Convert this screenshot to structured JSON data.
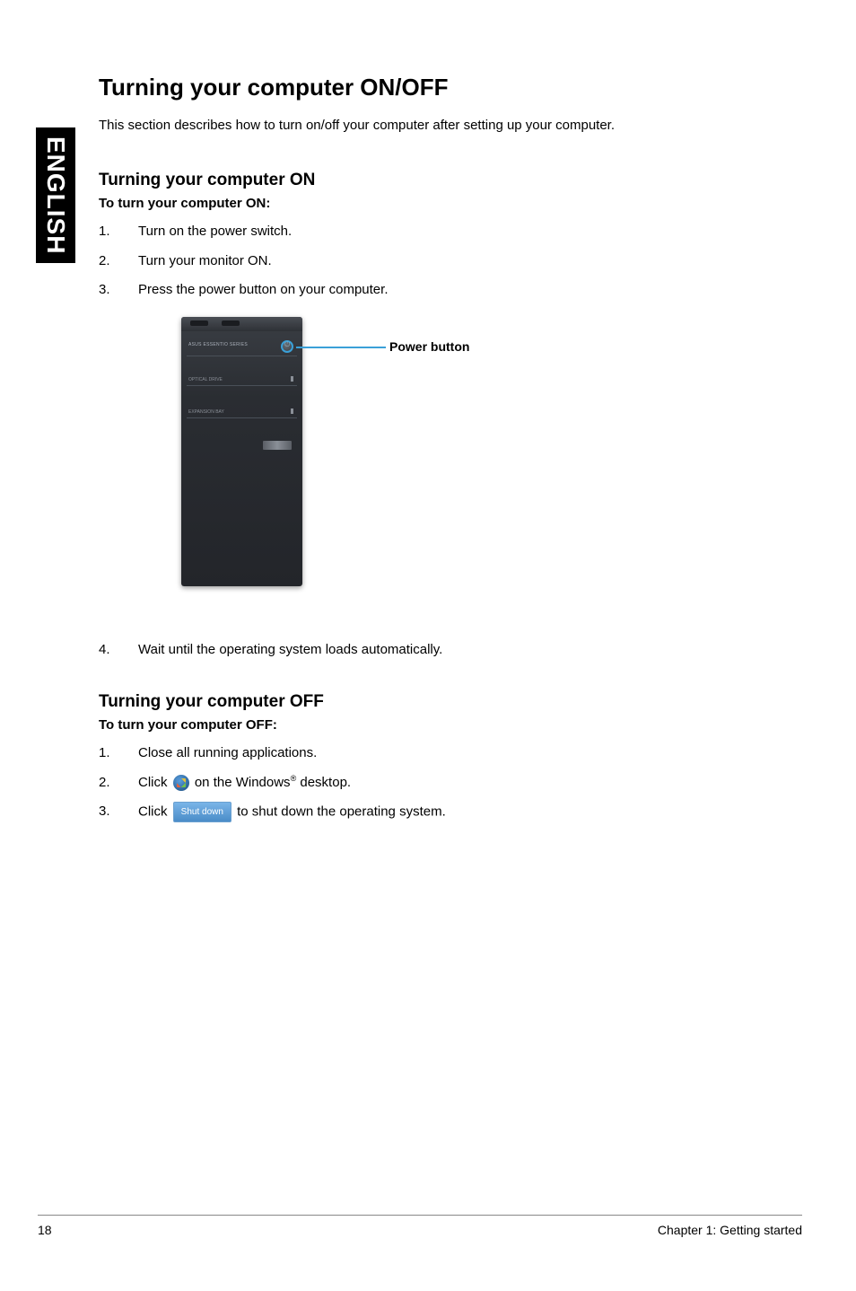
{
  "side_tab": "ENGLISH",
  "title": "Turning your computer ON/OFF",
  "intro": "This section describes how to turn on/off your computer after setting up your computer.",
  "on": {
    "heading": "Turning your computer ON",
    "subhead": "To turn your computer ON:",
    "steps": [
      {
        "num": "1.",
        "text": "Turn on the power switch."
      },
      {
        "num": "2.",
        "text": "Turn your monitor ON."
      },
      {
        "num": "3.",
        "text": "Press the power button on your computer."
      },
      {
        "num": "4.",
        "text": "Wait until the operating system loads automatically."
      }
    ]
  },
  "callout": {
    "label": "Power button"
  },
  "tower": {
    "brand": "ASUS ESSENTIO SERIES",
    "slot1": "OPTICAL DRIVE",
    "slot2": "EXPANSION BAY"
  },
  "off": {
    "heading": "Turning your computer OFF",
    "subhead": "To turn your computer OFF:",
    "steps": [
      {
        "num": "1.",
        "text": "Close all running applications."
      },
      {
        "num": "2.",
        "text_before": "Click ",
        "text_after": " on the Windows",
        "text_sup": "®",
        "text_end": " desktop."
      },
      {
        "num": "3.",
        "text_before": "Click ",
        "btn": "Shut down",
        "text_after": " to shut down the operating system."
      }
    ]
  },
  "footer": {
    "page": "18",
    "chapter": "Chapter 1: Getting started"
  }
}
